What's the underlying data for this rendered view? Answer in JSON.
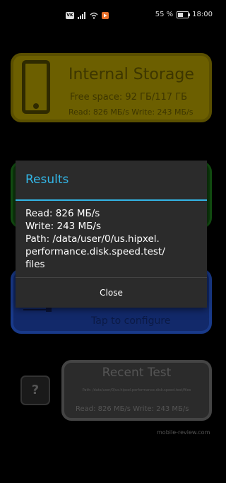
{
  "statusbar": {
    "vk_icon": "VK",
    "battery_percent": "55 %",
    "time": "18:00",
    "icons": [
      "vk-icon",
      "signal-icon",
      "wifi-icon",
      "notification-icon",
      "battery-icon"
    ]
  },
  "background": {
    "storage": {
      "title": "Internal Storage",
      "free_space": "Free space: 92 ГБ/117 ГБ",
      "speed": "Read: 826 МБ/s Write: 243 МБ/s"
    },
    "configure": {
      "label": "Tap to configure"
    },
    "help": {
      "label": "?"
    },
    "recent": {
      "title": "Recent Test",
      "path": "Path: /data/user/0/us.hipxel.performance.disk.speed.test/files",
      "speed": "Read: 826 МБ/s Write: 243 МБ/s"
    },
    "watermark": "mobile-review.com"
  },
  "dialog": {
    "title": "Results",
    "lines": [
      "Read: 826 МБ/s",
      "Write: 243 МБ/s",
      "Path: /data/user/0/us.hipxel.",
      "performance.disk.speed.test/",
      "files"
    ],
    "close_label": "Close"
  },
  "colors": {
    "accent": "#33b5e5",
    "storage_card": "#6c5f00",
    "green_card": "#0d3b0c",
    "blue_card": "#12296a",
    "dialog_bg": "#2b2b2b"
  }
}
